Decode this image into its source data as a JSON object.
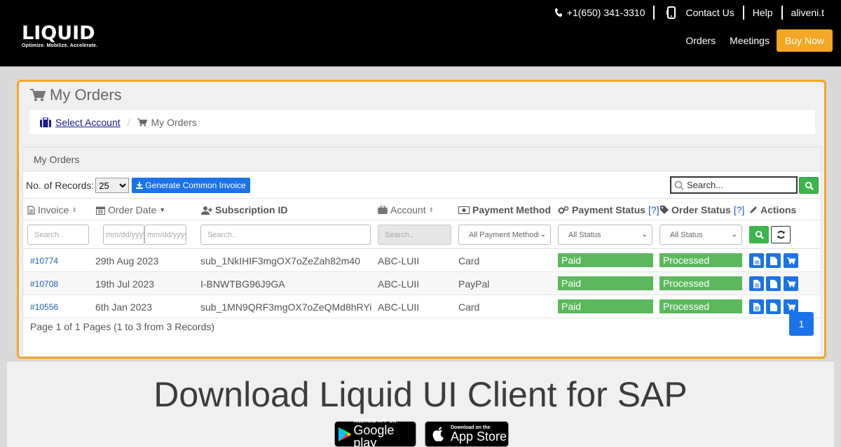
{
  "header": {
    "logo_text": "LIQUID",
    "logo_tagline": "Optimize. Mobilize. Accelerate.",
    "phone": "+1(650) 341-3310",
    "contact": "Contact Us",
    "help": "Help",
    "user": "aliveni.t",
    "nav": [
      "Orders",
      "Meetings"
    ],
    "buy_now": "Buy Now"
  },
  "page": {
    "title": "My Orders",
    "breadcrumb": {
      "link": "Select Account",
      "current": "My Orders"
    }
  },
  "panel": {
    "heading": "My Orders",
    "records_label": "No. of Records:",
    "records_value": "25",
    "generate_button": "Generate Common Invoice",
    "search_placeholder": "Search..."
  },
  "columns": {
    "invoice": "Invoice",
    "order_date": "Order Date",
    "subscription_id": "Subscription ID",
    "account": "Account",
    "payment_method": "Payment Method",
    "payment_status": "Payment Status",
    "order_status": "Order Status",
    "help_mark": "[?]",
    "actions": "Actions"
  },
  "filters": {
    "invoice_placeholder": "Search..",
    "date_placeholder": "mm/dd/yyyy",
    "subscription_placeholder": "Search..",
    "account_placeholder": "Search..",
    "payment_method": "All Payment Methods",
    "payment_status": "All Status",
    "order_status": "All Status"
  },
  "rows": [
    {
      "invoice": "#10774",
      "date": "29th Aug 2023",
      "subscription": "sub_1NkIHIF3mgOX7oZeZah82m40",
      "account": "ABC-LUII",
      "method": "Card",
      "payment_status": "Paid",
      "order_status": "Processed"
    },
    {
      "invoice": "#10708",
      "date": "19th Jul 2023",
      "subscription": "I-BNWTBG96J9GA",
      "account": "ABC-LUII",
      "method": "PayPal",
      "payment_status": "Paid",
      "order_status": "Processed"
    },
    {
      "invoice": "#10556",
      "date": "6th Jan 2023",
      "subscription": "sub_1MN9QRF3mgOX7oZeQMd8hRYi",
      "account": "ABC-LUII",
      "method": "Card",
      "payment_status": "Paid",
      "order_status": "Processed"
    }
  ],
  "pagination": {
    "summary": "Page 1 of 1 Pages (1 to 3 from 3 Records)",
    "current_page": "1"
  },
  "download": {
    "title": "Download Liquid UI Client for SAP",
    "google_small": "ANDROID APP ON",
    "google_large": "Google play",
    "apple_small": "Download on the",
    "apple_large": "App Store"
  },
  "colors": {
    "accent": "#f5a623",
    "primary": "#1a73e8",
    "success": "#5cb85c",
    "header_bg": "#000000"
  }
}
